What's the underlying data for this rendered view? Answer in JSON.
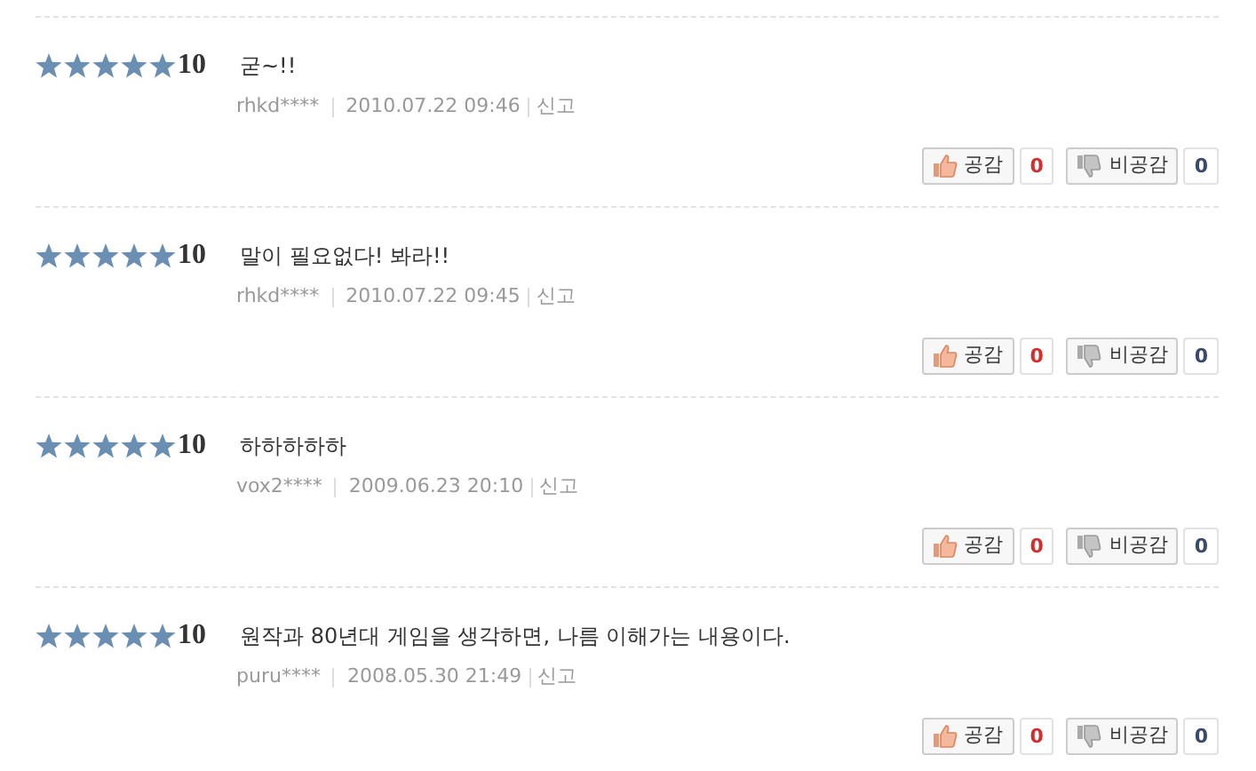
{
  "reviews": [
    {
      "stars": 5,
      "score": "10",
      "comment": "굳~!!",
      "user": "rhkd****",
      "date": "2010.07.22 09:46",
      "report": "신고",
      "like_label": "공감",
      "like_count": "0",
      "dislike_label": "비공감",
      "dislike_count": "0"
    },
    {
      "stars": 5,
      "score": "10",
      "comment": "말이 필요없다! 봐라!!",
      "user": "rhkd****",
      "date": "2010.07.22 09:45",
      "report": "신고",
      "like_label": "공감",
      "like_count": "0",
      "dislike_label": "비공감",
      "dislike_count": "0"
    },
    {
      "stars": 5,
      "score": "10",
      "comment": "하하하하하",
      "user": "vox2****",
      "date": "2009.06.23 20:10",
      "report": "신고",
      "like_label": "공감",
      "like_count": "0",
      "dislike_label": "비공감",
      "dislike_count": "0"
    },
    {
      "stars": 5,
      "score": "10",
      "comment": "원작과 80년대 게임을 생각하면, 나름 이해가는 내용이다.",
      "user": "puru****",
      "date": "2008.05.30 21:49",
      "report": "신고",
      "like_label": "공감",
      "like_count": "0",
      "dislike_label": "비공감",
      "dislike_count": "0"
    }
  ]
}
